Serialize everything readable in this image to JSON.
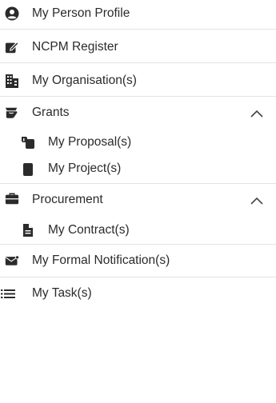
{
  "nav": {
    "items": [
      {
        "label": "My Person Profile",
        "icon": "user-circle-icon"
      },
      {
        "label": "NCPM Register",
        "icon": "pen-square-icon"
      },
      {
        "label": "My Organisation(s)",
        "icon": "building-icon"
      },
      {
        "label": "Grants",
        "icon": "hand-holding-icon",
        "expanded": true,
        "children": [
          {
            "label": "My Proposal(s)",
            "icon": "proposal-icon"
          },
          {
            "label": "My Project(s)",
            "icon": "clipboard-icon"
          }
        ]
      },
      {
        "label": "Procurement",
        "icon": "briefcase-icon",
        "expanded": true,
        "children": [
          {
            "label": "My Contract(s)",
            "icon": "file-icon"
          }
        ]
      },
      {
        "label": "My Formal Notification(s)",
        "icon": "envelope-open-icon"
      },
      {
        "label": "My Task(s)",
        "icon": "list-icon"
      }
    ]
  }
}
